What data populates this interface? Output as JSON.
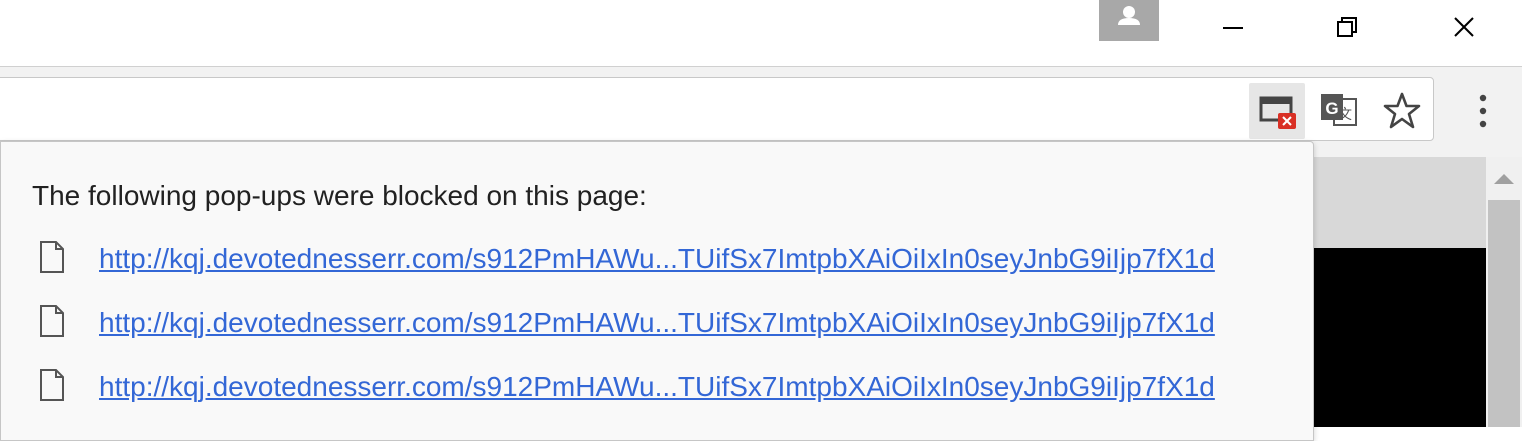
{
  "window": {
    "controls": [
      "minimize",
      "restore",
      "close"
    ],
    "avatar_icon": "person-icon"
  },
  "toolbar": {
    "icons": [
      "popup-blocked-icon",
      "translate-icon",
      "star-icon",
      "menu-icon"
    ]
  },
  "popup_bubble": {
    "title": "The following pop-ups were blocked on this page:",
    "items": [
      {
        "url": "http://kqj.devotednesserr.com/s912PmHAWu...TUifSx7ImtpbXAiOiIxIn0seyJnbG9iIjp7fX1d",
        "icon": "document-icon"
      },
      {
        "url": "http://kqj.devotednesserr.com/s912PmHAWu...TUifSx7ImtpbXAiOiIxIn0seyJnbG9iIjp7fX1d",
        "icon": "document-icon"
      },
      {
        "url": "http://kqj.devotednesserr.com/s912PmHAWu...TUifSx7ImtpbXAiOiIxIn0seyJnbG9iIjp7fX1d",
        "icon": "document-icon"
      }
    ]
  },
  "colors": {
    "link": "#3367d6",
    "blocked_badge": "#d93025",
    "avatar_bg": "#a8a8a8"
  }
}
